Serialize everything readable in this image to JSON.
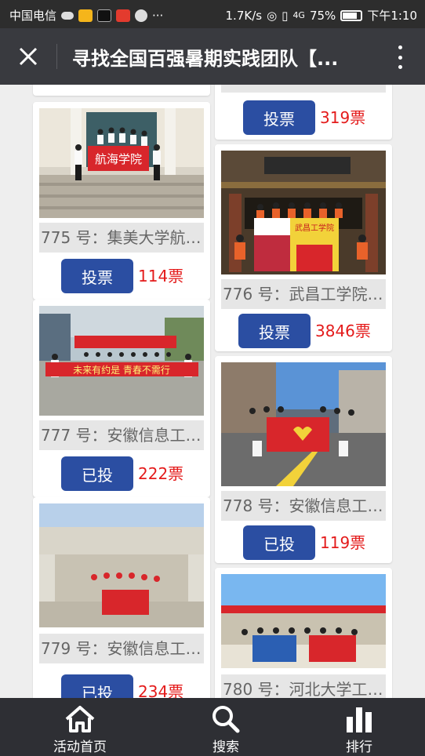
{
  "status_bar": {
    "carrier": "中国电信",
    "speed": "1.7K/s",
    "network": "4G",
    "battery": "75%",
    "time": "下午1:10"
  },
  "header": {
    "title": "寻找全国百强暑期实践团队【..."
  },
  "cards": [
    {
      "id": "partial-left",
      "caption": "",
      "button": "",
      "votes": ""
    },
    {
      "id": "partial-right",
      "caption": "",
      "button": "投票",
      "votes": "319票"
    },
    {
      "id": "775",
      "caption": "775 号：集美大学航…",
      "button": "投票",
      "votes": "114票",
      "photo_text": "航海学院"
    },
    {
      "id": "776",
      "caption": "776 号：武昌工学院…",
      "button": "投票",
      "votes": "3846票",
      "photo_text": "武昌工学院"
    },
    {
      "id": "777",
      "caption": "777 号：安徽信息工…",
      "button": "已投",
      "votes": "222票",
      "photo_text": "未来有约是  青春不需行"
    },
    {
      "id": "778",
      "caption": "778 号：安徽信息工…",
      "button": "已投",
      "votes": "119票",
      "photo_text": ""
    },
    {
      "id": "779",
      "caption": "779 号：安徽信息工…",
      "button": "已投",
      "votes": "234票",
      "photo_text": ""
    },
    {
      "id": "780",
      "caption": "780 号：河北大学工…",
      "button": "",
      "votes": "",
      "photo_text": ""
    }
  ],
  "nav": {
    "home": "活动首页",
    "search": "搜索",
    "rank": "排行"
  },
  "colors": {
    "accent": "#2b4ea2",
    "votes": "#e41b1b",
    "header_bg": "#393a3f",
    "nav_bg": "#2e2f34"
  }
}
